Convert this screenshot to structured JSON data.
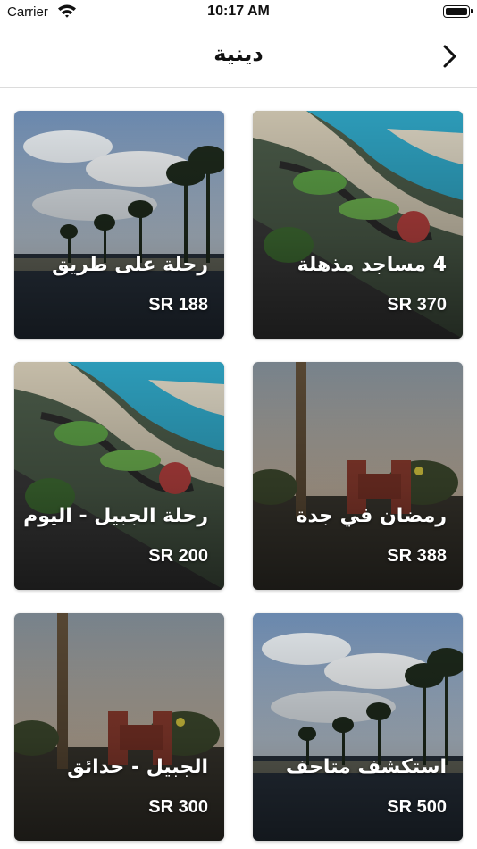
{
  "status_bar": {
    "carrier": "Carrier",
    "time": "10:17 AM",
    "icons": [
      "wifi-icon",
      "battery-icon"
    ]
  },
  "nav": {
    "title": "دينية",
    "back_icon": "chevron-right-icon"
  },
  "cards": [
    {
      "title": "4 مساجد مذهلة",
      "price": "SR 370",
      "scene": "coast"
    },
    {
      "title": "رحلة على طريق",
      "price": "SR 188",
      "scene": "palms"
    },
    {
      "title": "رمضان في جدة",
      "price": "SR 388",
      "scene": "park"
    },
    {
      "title": "رحلة الجبيل - اليوم",
      "price": "SR 200",
      "scene": "coast"
    },
    {
      "title": "استكشف متاحف",
      "price": "SR 500",
      "scene": "palms"
    },
    {
      "title": "الجبيل - حدائق",
      "price": "SR 300",
      "scene": "park"
    }
  ]
}
